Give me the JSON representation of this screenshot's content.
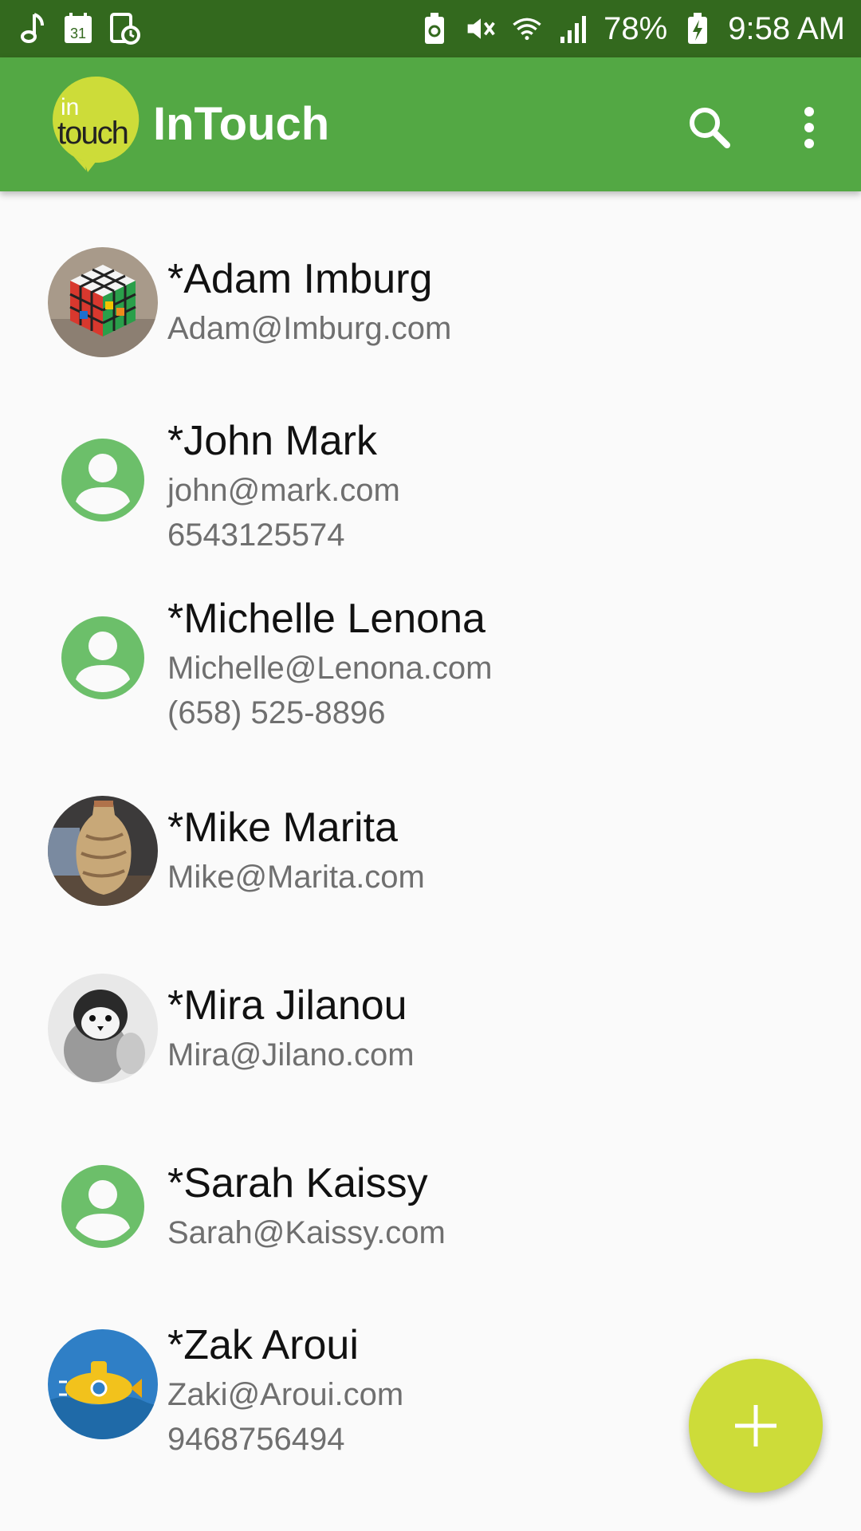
{
  "status_bar": {
    "battery_percent": "78%",
    "time": "9:58 AM",
    "left_icons": [
      "music-note-icon",
      "calendar-icon",
      "screen-record-icon"
    ],
    "calendar_day": "31",
    "right_icons": [
      "battery-saver-icon",
      "vibrate-mute-icon",
      "wifi-icon",
      "signal-icon",
      "battery-charging-icon"
    ]
  },
  "app_bar": {
    "logo_text_top": "in",
    "logo_text_bottom": "touch",
    "title": "InTouch",
    "icons": [
      "search-icon",
      "more-vert-icon"
    ]
  },
  "contacts": [
    {
      "name": "*Adam Imburg",
      "email": "Adam@Imburg.com",
      "phone": "",
      "avatar": "rubiks-cube-photo"
    },
    {
      "name": "*John Mark",
      "email": "john@mark.com",
      "phone": "6543125574",
      "avatar": "default-person-icon"
    },
    {
      "name": "*Michelle Lenona",
      "email": "Michelle@Lenona.com",
      "phone": "(658) 525-8896",
      "avatar": "default-person-icon"
    },
    {
      "name": "*Mike Marita",
      "email": "Mike@Marita.com",
      "phone": "",
      "avatar": "vase-photo"
    },
    {
      "name": "*Mira Jilanou",
      "email": "Mira@Jilano.com",
      "phone": "",
      "avatar": "penguin-photo"
    },
    {
      "name": "*Sarah Kaissy",
      "email": "Sarah@Kaissy.com",
      "phone": "",
      "avatar": "default-person-icon"
    },
    {
      "name": "*Zak Aroui",
      "email": "Zaki@Aroui.com",
      "phone": "9468756494",
      "avatar": "submarine-photo"
    }
  ],
  "fab": {
    "icon": "plus-icon"
  },
  "colors": {
    "status_bar": "#33691e",
    "app_bar": "#53a844",
    "logo": "#cddc39",
    "fab": "#cddc39",
    "default_avatar": "#6cbf6a"
  }
}
